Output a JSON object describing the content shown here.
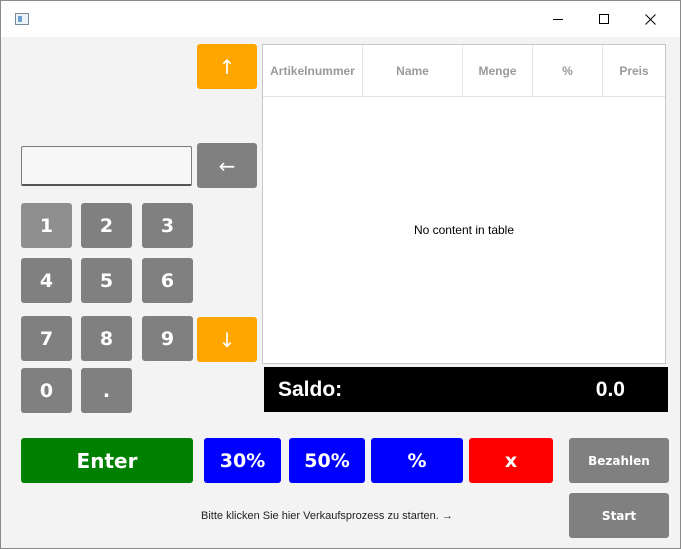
{
  "window": {
    "title": ""
  },
  "keypad": {
    "up_arrow": "↑",
    "down_arrow": "↓",
    "backspace": "←",
    "digits": [
      "1",
      "2",
      "3",
      "4",
      "5",
      "6",
      "7",
      "8",
      "9",
      "0"
    ],
    "dot": "."
  },
  "input": {
    "value": ""
  },
  "table": {
    "columns": [
      "Artikelnummer",
      "Name",
      "Menge",
      "%",
      "Preis"
    ],
    "empty_message": "No content in table"
  },
  "saldo": {
    "label": "Saldo:",
    "value": "0.0"
  },
  "actions": {
    "enter": "Enter",
    "discount_30": "30%",
    "discount_50": "50%",
    "percent": "%",
    "remove": "x",
    "pay": "Bezahlen",
    "start": "Start"
  },
  "hint": "Bitte klicken Sie hier Verkaufsprozess zu starten. →",
  "colors": {
    "keypad_gray": "#808080",
    "orange": "#ffa500",
    "green": "#008000",
    "blue": "#0000ff",
    "red": "#ff0000",
    "saldo_bg": "#000000"
  }
}
